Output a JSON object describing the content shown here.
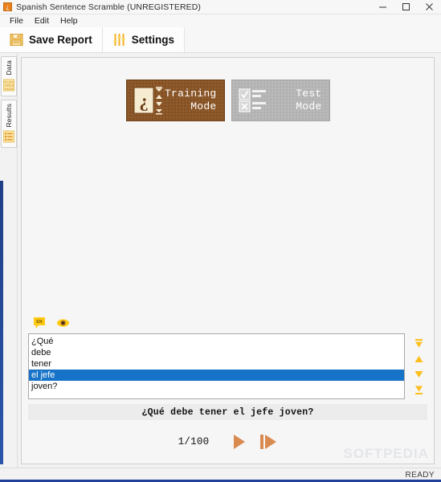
{
  "window": {
    "title": "Spanish Sentence Scramble (UNREGISTERED)",
    "app_icon": "question-mark-icon",
    "minimize": "–",
    "maximize": "□",
    "close": "✕"
  },
  "menubar": {
    "items": [
      {
        "label": "File"
      },
      {
        "label": "Edit"
      },
      {
        "label": "Help"
      }
    ]
  },
  "toolbar": {
    "buttons": [
      {
        "label": "Save Report",
        "icon": "floppy-disk-icon"
      },
      {
        "label": "Settings",
        "icon": "sliders-icon"
      }
    ]
  },
  "sidetabs": {
    "items": [
      {
        "label": "Data",
        "icon": "binary-digits-icon"
      },
      {
        "label": "Results",
        "icon": "list-lines-icon"
      }
    ]
  },
  "modes": {
    "training": {
      "label": "Training\nMode",
      "icon": "inverted-question-card-icon",
      "active": true,
      "color": "#8a5526"
    },
    "test": {
      "label": "Test\nMode",
      "icon": "checkbox-list-icon",
      "active": false,
      "color": "#b6b6b6"
    }
  },
  "scramble": {
    "tools": [
      {
        "name": "translate-en-icon",
        "label": "EN"
      },
      {
        "name": "eye-reveal-icon",
        "label": ""
      }
    ],
    "words": [
      {
        "text": "¿Qué",
        "selected": false
      },
      {
        "text": "debe",
        "selected": false
      },
      {
        "text": "tener",
        "selected": false
      },
      {
        "text": "el jefe",
        "selected": true
      },
      {
        "text": "joven?",
        "selected": false
      }
    ],
    "arrows": [
      {
        "name": "move-to-top-button"
      },
      {
        "name": "move-up-button"
      },
      {
        "name": "move-down-button"
      },
      {
        "name": "move-to-bottom-button"
      }
    ],
    "sentence": "¿Qué debe tener el jefe joven?",
    "counter": "1/100",
    "playback": [
      {
        "name": "play-button"
      },
      {
        "name": "next-button"
      }
    ]
  },
  "watermark": "SOFTPEDIA",
  "statusbar": {
    "text": "READY"
  },
  "colors": {
    "accent_brown": "#8a5526",
    "accent_orange": "#e8821e",
    "selection_blue": "#1673c8",
    "arrow_yellow": "#fcbf1e",
    "play_orange": "#d98a4f"
  }
}
